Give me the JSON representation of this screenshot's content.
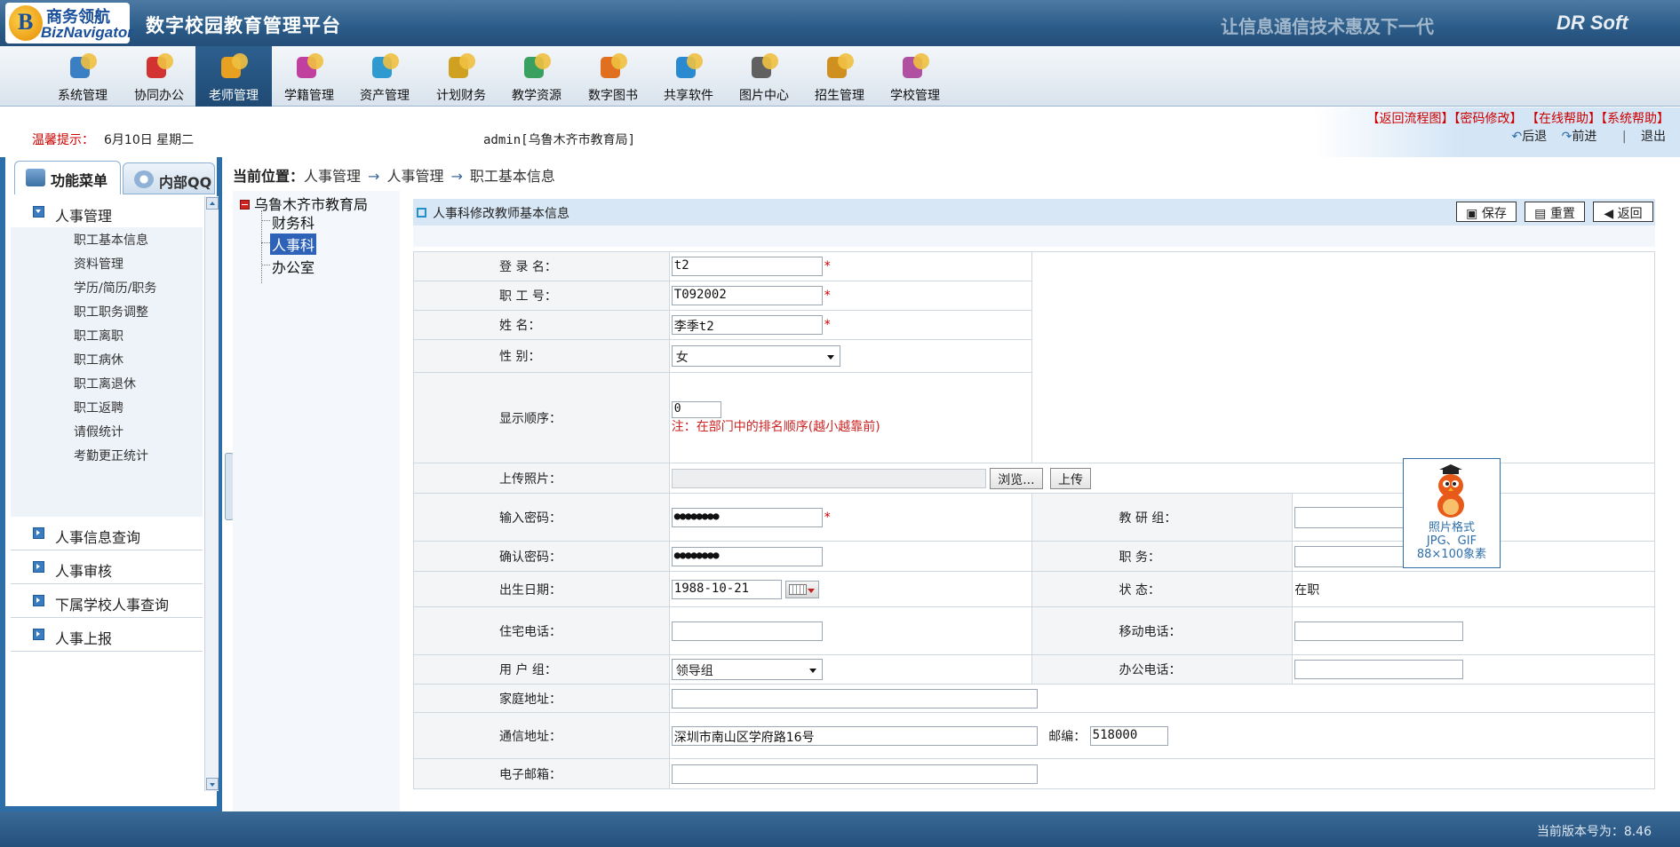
{
  "header": {
    "logo_cn": "商务领航",
    "logo_en": "BizNavigator",
    "app_title": "数字校园教育管理平台",
    "slogan": "让信息通信技术惠及下一代",
    "brand": "DR Soft"
  },
  "nav": {
    "items": [
      {
        "label": "系统管理",
        "icon": "system-icon",
        "color": "#3a7fc4"
      },
      {
        "label": "协同办公",
        "icon": "checkmark-icon",
        "color": "#d23232"
      },
      {
        "label": "老师管理",
        "icon": "teacher-icon",
        "color": "#e8a020",
        "active": true
      },
      {
        "label": "学籍管理",
        "icon": "students-icon",
        "color": "#c040a0"
      },
      {
        "label": "资产管理",
        "icon": "assets-icon",
        "color": "#2f9ad0"
      },
      {
        "label": "计划财务",
        "icon": "finance-icon",
        "color": "#d0a020"
      },
      {
        "label": "教学资源",
        "icon": "resource-icon",
        "color": "#3aa060"
      },
      {
        "label": "数字图书",
        "icon": "book-icon",
        "color": "#e07020"
      },
      {
        "label": "共享软件",
        "icon": "software-icon",
        "color": "#2a8ad0"
      },
      {
        "label": "图片中心",
        "icon": "photo-icon",
        "color": "#606060"
      },
      {
        "label": "招生管理",
        "icon": "enroll-icon",
        "color": "#d09020"
      },
      {
        "label": "学校管理",
        "icon": "school-icon",
        "color": "#b050a0"
      }
    ]
  },
  "infobar": {
    "warm_label": "温馨提示：",
    "date": "6月10日  星期二",
    "user": "admin[乌鲁木齐市教育局]",
    "top_links": [
      "【返回流程图】",
      "【密码修改】",
      "【在线帮助】",
      "【系统帮助】"
    ],
    "back": "后退",
    "forward": "前进",
    "logout": "退出"
  },
  "left": {
    "tab_func": "功能菜单",
    "tab_qq": "内部QQ",
    "groups": [
      {
        "label": "人事管理",
        "open": true
      },
      {
        "label": "人事信息查询"
      },
      {
        "label": "人事审核"
      },
      {
        "label": "下属学校人事查询"
      },
      {
        "label": "人事上报"
      }
    ],
    "sub_items": [
      "职工基本信息",
      "资料管理",
      "学历/简历/职务",
      "职工职务调整",
      "职工离职",
      "职工病休",
      "职工离退休",
      "职工返聘",
      "请假统计",
      "考勤更正统计"
    ]
  },
  "breadcrumb": {
    "prefix": "当前位置：",
    "items": [
      "人事管理",
      "人事管理",
      "职工基本信息"
    ],
    "arrow": "→"
  },
  "tree": {
    "root": "乌鲁木齐市教育局",
    "children": [
      "财务科",
      "人事科",
      "办公室"
    ],
    "selected": "人事科"
  },
  "form": {
    "title": "人事科修改教师基本信息",
    "buttons": {
      "save": "保存",
      "reset": "重置",
      "back": "返回"
    },
    "labels": {
      "login": "登 录 名：",
      "staff_no": "职 工 号：",
      "name": "姓    名：",
      "gender": "性    别：",
      "order": "显示顺序：",
      "photo": "上传照片：",
      "password": "输入密码：",
      "confirm": "确认密码：",
      "birth": "出生日期：",
      "home_phone": "住宅电话：",
      "user_group": "用 户 组：",
      "home_addr": "家庭地址：",
      "mail_addr": "通信地址：",
      "email": "电子邮箱：",
      "research": "教 研 组：",
      "duty": "职    务：",
      "status": "状    态：",
      "mobile": "移动电话：",
      "office_phone": "办公电话：",
      "postcode": "邮编："
    },
    "values": {
      "login": "t2",
      "staff_no": "T092002",
      "name": "李季t2",
      "gender": "女",
      "order": "0",
      "order_note": "注：在部门中的排名顺序(越小越靠前)",
      "password": "●●●●●●●●",
      "confirm": "●●●●●●●●",
      "birth": "1988-10-21",
      "home_phone": "",
      "user_group": "领导组",
      "home_addr": "",
      "mail_addr": "深圳市南山区学府路16号",
      "postcode": "518000",
      "email": "",
      "research": "",
      "duty": "",
      "status": "在职",
      "mobile": "",
      "office_phone": ""
    },
    "browse_btn": "浏览...",
    "upload_btn": "上传",
    "photo_caption": [
      "照片格式",
      "JPG、GIF",
      "88×100象素"
    ],
    "required_mark": "*"
  },
  "footer": {
    "version": "当前版本号为：8.46"
  },
  "colors": {
    "header": "#2b5b88",
    "accent_red": "#cc0000",
    "selected": "#2d62b8"
  }
}
